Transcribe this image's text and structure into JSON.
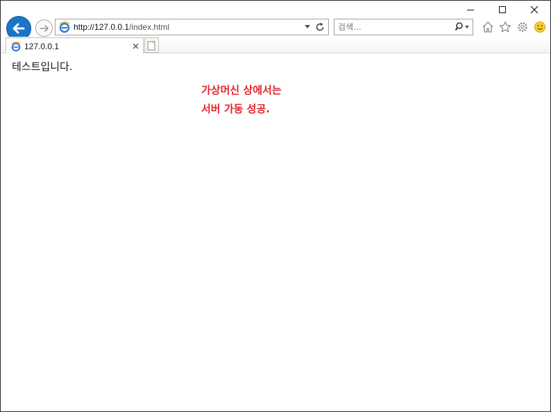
{
  "window": {
    "controls": {
      "minimize": "minimize",
      "maximize": "maximize",
      "close": "close"
    }
  },
  "nav": {
    "address": {
      "scheme_host": "http://127.0.0.1",
      "path": "/index.html"
    },
    "search": {
      "placeholder": "검색..."
    }
  },
  "tabs": [
    {
      "label": "127.0.0.1"
    }
  ],
  "icons": {
    "back": "back-arrow-icon",
    "forward": "forward-arrow-icon",
    "page": "ie-logo-icon",
    "refresh": "refresh-icon",
    "search": "search-icon",
    "home": "home-icon",
    "favorites": "star-icon",
    "tools": "gear-icon",
    "feedback": "smiley-icon",
    "new_tab": "new-tab-icon"
  },
  "colors": {
    "back_button": "#1a75c9",
    "message": "#e4242b"
  },
  "page": {
    "text": "테스트입니다.",
    "message_line1": "가상머신 상에서는",
    "message_line2": "서버 가동 성공."
  }
}
